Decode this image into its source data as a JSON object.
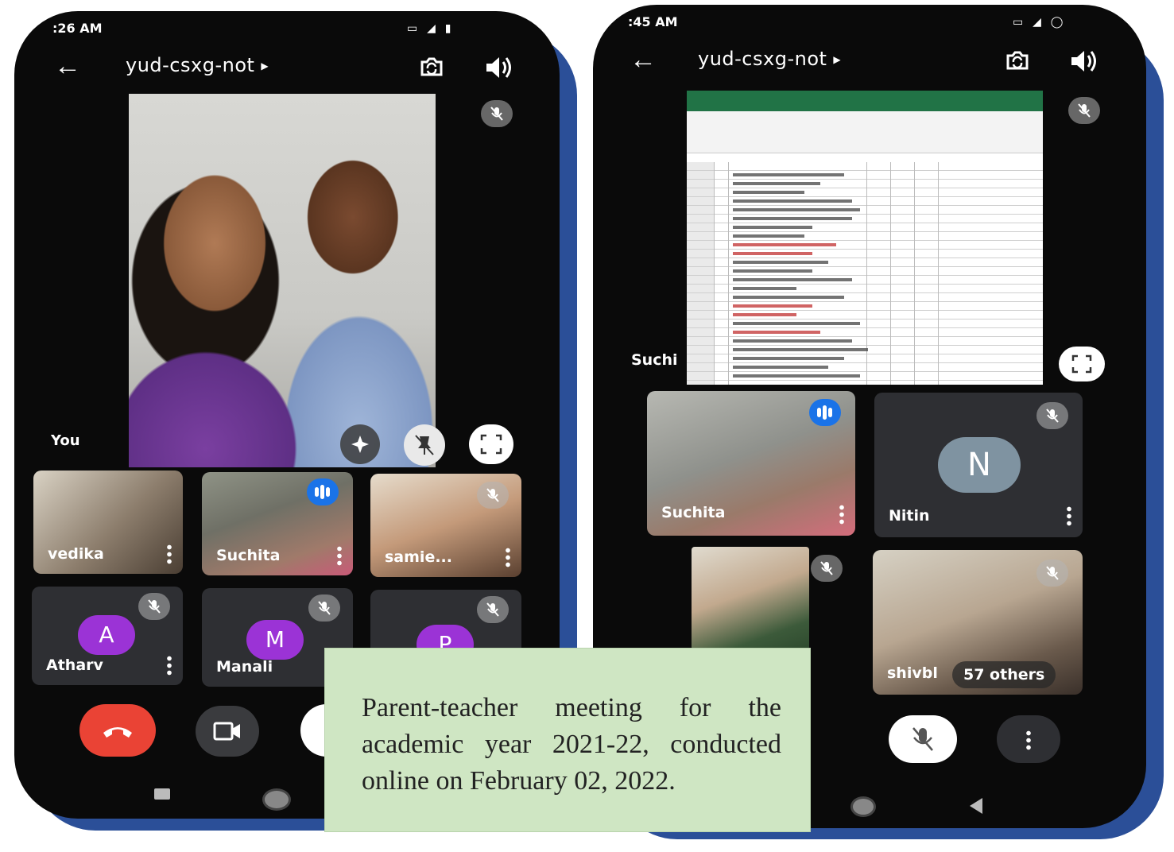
{
  "left_phone": {
    "status_time": ":26 AM",
    "meeting_code": "yud-csxg-not",
    "main_tile_label": "You",
    "tiles": [
      {
        "name": "vedika"
      },
      {
        "name": "Suchita"
      },
      {
        "name": "samie..."
      },
      {
        "name": "Atharv",
        "initial": "A",
        "avatar_color": "#9b33d6"
      },
      {
        "name": "Manali",
        "initial": "M",
        "avatar_color": "#9b33d6"
      },
      {
        "name": "",
        "initial": "P",
        "avatar_color": "#9b33d6"
      }
    ]
  },
  "right_phone": {
    "status_time": ":45 AM",
    "meeting_code": "yud-csxg-not",
    "presenter_label": "Suchi",
    "tiles": [
      {
        "name": "Suchita"
      },
      {
        "name": "Nitin",
        "initial": "N",
        "avatar_color": "#7f93a1"
      },
      {
        "name": ""
      },
      {
        "name": "shivbl"
      }
    ],
    "others_label": "57 others"
  },
  "caption": {
    "line1": "Parent-teacher meeting for the",
    "line2": "academic year 2021-22, conducted",
    "line3": "online on February 02, 2022."
  },
  "colors": {
    "hangup": "#ea4335",
    "phone_frame": "#2b4f98",
    "caption_bg": "#cfe6c3",
    "speaking": "#1a73e8"
  }
}
